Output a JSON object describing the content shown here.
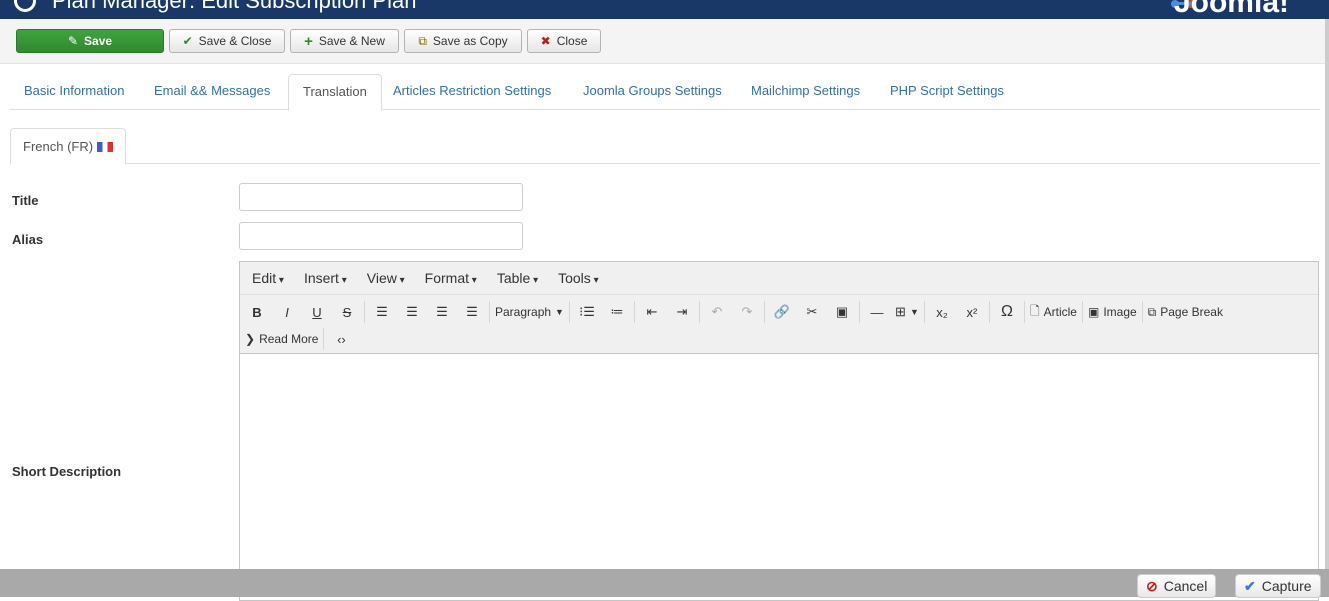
{
  "header": {
    "title": "Plan Manager: Edit Subscription Plan",
    "logo": "Joomla!"
  },
  "toolbar": {
    "save": "Save",
    "save_close": "Save & Close",
    "save_new": "Save & New",
    "save_copy": "Save as Copy",
    "close": "Close"
  },
  "tabs": [
    "Basic Information",
    "Email && Messages",
    "Translation",
    "Articles Restriction Settings",
    "Joomla Groups Settings",
    "Mailchimp Settings",
    "PHP Script Settings"
  ],
  "active_tab": "Translation",
  "language_tab": "French (FR)",
  "form": {
    "title_label": "Title",
    "title_value": "",
    "alias_label": "Alias",
    "alias_value": "",
    "short_description_label": "Short Description"
  },
  "editor": {
    "menu": [
      "Edit",
      "Insert",
      "View",
      "Format",
      "Table",
      "Tools"
    ],
    "paragraph": "Paragraph",
    "article": "Article",
    "image": "Image",
    "page_break": "Page Break",
    "read_more": "Read More"
  },
  "overlay": {
    "cancel": "Cancel",
    "capture": "Capture"
  },
  "colors": {
    "header": "#1a3867",
    "save": "#2f8a2e",
    "link": "#3071a9"
  }
}
